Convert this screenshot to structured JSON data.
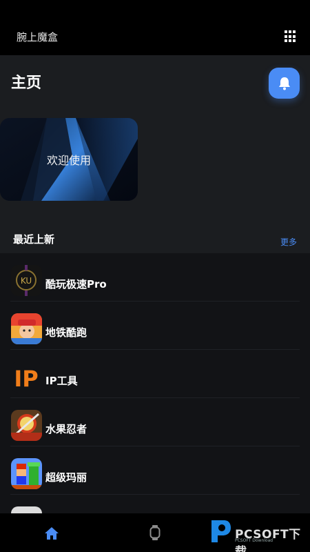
{
  "header": {
    "app_title": "腕上魔盒",
    "menu_icon": "grid-icon"
  },
  "main": {
    "page_title": "主页",
    "bell_icon": "bell-icon",
    "banner_text": "欢迎使用",
    "section_title": "最近上新",
    "more_label": "更多"
  },
  "list": [
    {
      "name": "酷玩极速Pro",
      "icon": "kuwan-app-icon"
    },
    {
      "name": "地铁酷跑",
      "icon": "subway-surfers-app-icon"
    },
    {
      "name": "IP工具",
      "icon": "ip-tool-app-icon"
    },
    {
      "name": "水果忍者",
      "icon": "fruit-ninja-app-icon"
    },
    {
      "name": "超级玛丽",
      "icon": "super-mario-app-icon"
    }
  ],
  "tabbar": {
    "items": [
      {
        "icon": "home-icon",
        "active": true
      },
      {
        "icon": "watch-icon",
        "active": false
      }
    ],
    "watermark": "PCSOFT下载",
    "watermark_sub": "PCSOFT Download"
  },
  "colors": {
    "accent": "#4a8cf5",
    "background": "#1b1d20",
    "list_background": "#121316"
  }
}
